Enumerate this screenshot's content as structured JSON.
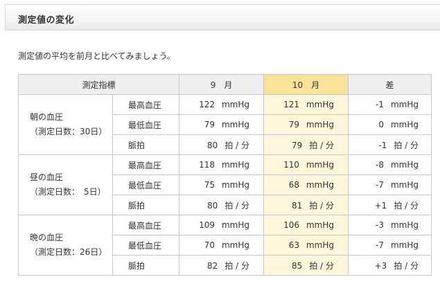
{
  "section": {
    "title": "測定値の変化"
  },
  "intro": "測定値の平均を前月と比べてみましょう。",
  "table": {
    "headers": {
      "indicator": "測定指標",
      "prev_month": "9　月",
      "curr_month": "10　月",
      "diff": "差"
    },
    "groups": [
      {
        "name": "朝の血圧",
        "days": "（測定日数：30日）",
        "rows": [
          {
            "metric": "最高血圧",
            "prev": "122",
            "curr": "121",
            "diff": "-1",
            "unit": "mmHg"
          },
          {
            "metric": "最低血圧",
            "prev": "79",
            "curr": "79",
            "diff": "0",
            "unit": "mmHg"
          },
          {
            "metric": "脈拍",
            "prev": "80",
            "curr": "79",
            "diff": "-1",
            "unit": "拍 / 分"
          }
        ]
      },
      {
        "name": "昼の血圧",
        "days": "（測定日数：　5日）",
        "rows": [
          {
            "metric": "最高血圧",
            "prev": "118",
            "curr": "110",
            "diff": "-8",
            "unit": "mmHg"
          },
          {
            "metric": "最低血圧",
            "prev": "75",
            "curr": "68",
            "diff": "-7",
            "unit": "mmHg"
          },
          {
            "metric": "脈拍",
            "prev": "80",
            "curr": "81",
            "diff": "+1",
            "unit": "拍 / 分"
          }
        ]
      },
      {
        "name": "晩の血圧",
        "days": "（測定日数：26日）",
        "rows": [
          {
            "metric": "最高血圧",
            "prev": "109",
            "curr": "106",
            "diff": "-3",
            "unit": "mmHg"
          },
          {
            "metric": "最低血圧",
            "prev": "70",
            "curr": "63",
            "diff": "-7",
            "unit": "mmHg"
          },
          {
            "metric": "脈拍",
            "prev": "82",
            "curr": "85",
            "diff": "+3",
            "unit": "拍 / 分"
          }
        ]
      }
    ]
  },
  "colors": {
    "current_month_header": "#fbe29a",
    "current_month_cell": "#fff6db",
    "header_background": "#efefef",
    "border": "#c8c8c8"
  }
}
